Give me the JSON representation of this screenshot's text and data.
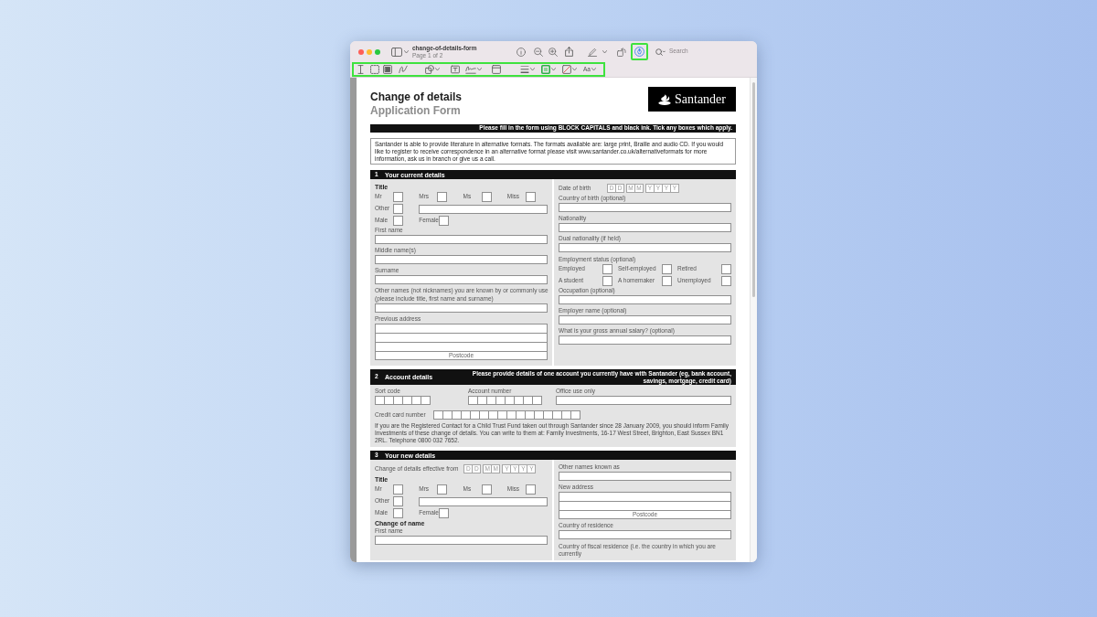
{
  "window": {
    "title": "change-of-details-form",
    "subtitle": "Page 1 of 2",
    "search": {
      "placeholder": "Search"
    },
    "markup_button": {
      "highlighted": true
    }
  },
  "markup_toolbar": {
    "highlighted": true,
    "font_button": "Aa"
  },
  "document": {
    "title": "Change of details",
    "subtitle": "Application Form",
    "logo": "Santander",
    "instruction": "Please fill in the form using BLOCK CAPITALS and black ink. Tick any boxes which apply.",
    "notice": "Santander is able to provide literature in alternative formats. The formats available are: large print, Braille and audio CD. If you would like to register to receive correspondence in an alternative format please visit www.santander.co.uk/alternativeformats for more information, ask us in branch or give us a call.",
    "sections": [
      {
        "number": "1",
        "title": "Your current details",
        "kind": "columns",
        "left": [
          {
            "kind": "heading",
            "text": "Title"
          },
          {
            "kind": "checks",
            "options": [
              {
                "label": "Mr",
                "checked": false
              },
              {
                "label": "Mrs",
                "checked": false
              },
              {
                "label": "Ms",
                "checked": false
              },
              {
                "label": "Miss",
                "checked": false
              }
            ]
          },
          {
            "kind": "other",
            "label": "Other",
            "checked": false
          },
          {
            "kind": "checks",
            "options": [
              {
                "label": "Male",
                "checked": false
              },
              {
                "label": "Female",
                "checked": false
              }
            ]
          },
          {
            "kind": "field",
            "label": "First name"
          },
          {
            "kind": "field",
            "label": "Middle name(s)"
          },
          {
            "kind": "field",
            "label": "Surname"
          },
          {
            "kind": "field",
            "label": "Other names (not nicknames) you are known by or commonly use",
            "hint": "(please include title, first name and surname)"
          },
          {
            "kind": "address",
            "label": "Previous address",
            "postcode": "Postcode"
          }
        ],
        "right": [
          {
            "kind": "date",
            "label": "Date of birth",
            "groups": [
              [
                "D",
                "D"
              ],
              [
                "M",
                "M"
              ],
              [
                "Y",
                "Y",
                "Y",
                "Y"
              ]
            ]
          },
          {
            "kind": "field",
            "label": "Country of birth (optional)"
          },
          {
            "kind": "field",
            "label": "Nationality"
          },
          {
            "kind": "field",
            "label": "Dual nationality (if held)"
          },
          {
            "kind": "label",
            "text": "Employment status (optional)"
          },
          {
            "kind": "choices",
            "options": [
              {
                "label": "Employed",
                "checked": false
              },
              {
                "label": "Self-employed",
                "checked": false
              },
              {
                "label": "Retired",
                "checked": false
              }
            ]
          },
          {
            "kind": "choices",
            "options": [
              {
                "label": "A student",
                "checked": false
              },
              {
                "label": "A homemaker",
                "checked": false
              },
              {
                "label": "Unemployed",
                "checked": false
              }
            ]
          },
          {
            "kind": "field",
            "label": "Occupation (optional)"
          },
          {
            "kind": "field",
            "label": "Employer name (optional)"
          },
          {
            "kind": "field",
            "label": "What is your gross annual salary? (optional)"
          }
        ]
      },
      {
        "number": "2",
        "title": "Account details",
        "note": "Please provide details of one account you currently have with Santander (eg, bank account, savings, mortgage, credit card)",
        "kind": "rows",
        "rows": [
          [
            {
              "kind": "sort-code",
              "label": "Sort code"
            },
            {
              "kind": "account-number",
              "label": "Account number"
            },
            {
              "kind": "field",
              "label": "Office use only"
            }
          ],
          [
            {
              "kind": "card-number",
              "label": "Credit card number"
            }
          ],
          [
            {
              "kind": "paragraph",
              "text": "If you are the Registered Contact for a Child Trust Fund taken out through Santander since 28 January 2009, you should inform Family Investments of these change of details. You can write to them at: Family Investments, 16-17 West Street, Brighton, East Sussex BN1 2RL. Telephone 0800 032 7652."
            }
          ]
        ]
      },
      {
        "number": "3",
        "title": "Your new details",
        "kind": "columns",
        "left": [
          {
            "kind": "date",
            "label": "Change of details effective from",
            "groups": [
              [
                "D",
                "D"
              ],
              [
                "M",
                "M"
              ],
              [
                "Y",
                "Y",
                "Y",
                "Y"
              ]
            ]
          },
          {
            "kind": "heading",
            "text": "Title"
          },
          {
            "kind": "checks",
            "options": [
              {
                "label": "Mr",
                "checked": false
              },
              {
                "label": "Mrs",
                "checked": false
              },
              {
                "label": "Ms",
                "checked": false
              },
              {
                "label": "Miss",
                "checked": false
              }
            ]
          },
          {
            "kind": "other",
            "label": "Other",
            "checked": false
          },
          {
            "kind": "checks",
            "options": [
              {
                "label": "Male",
                "checked": false
              },
              {
                "label": "Female",
                "checked": false
              }
            ]
          },
          {
            "kind": "heading",
            "text": "Change of name"
          },
          {
            "kind": "field",
            "label": "First name"
          }
        ],
        "right": [
          {
            "kind": "field",
            "label": "Other names known as"
          },
          {
            "kind": "address-short",
            "label": "New address",
            "postcode": "Postcode"
          },
          {
            "kind": "field",
            "label": "Country of residence"
          },
          {
            "kind": "label",
            "text": "Country of fiscal residence (i.e. the country in which you are currently"
          }
        ]
      }
    ]
  }
}
